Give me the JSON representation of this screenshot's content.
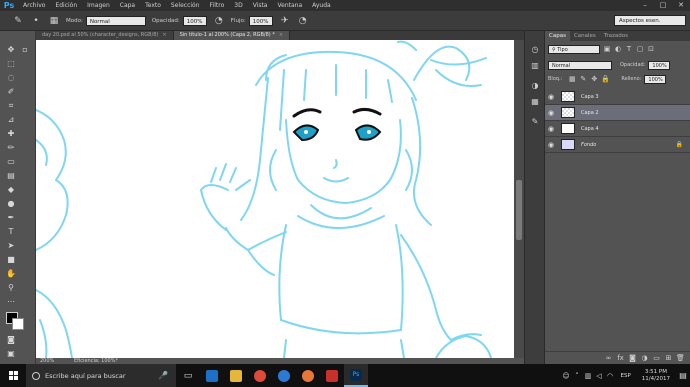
{
  "app": {
    "logo": "Ps"
  },
  "menu": [
    "Archivo",
    "Edición",
    "Imagen",
    "Capa",
    "Texto",
    "Selección",
    "Filtro",
    "3D",
    "Vista",
    "Ventana",
    "Ayuda"
  ],
  "window_controls": {
    "minimize": "–",
    "maximize": "□",
    "close": "✕"
  },
  "options": {
    "mode_label": "Modo:",
    "mode_value": "Normal",
    "opacity_label": "Opacidad:",
    "opacity_value": "100%",
    "flow_label": "Flujo:",
    "flow_value": "100%",
    "workspace": "Aspectos esen."
  },
  "tabs": [
    {
      "label": "day 20.psd al 50% (character_designs, RGB/8)",
      "active": false
    },
    {
      "label": "Sin título-1 al 200% (Capa 2, RGB/8) *",
      "active": true
    }
  ],
  "status": {
    "zoom": "200%",
    "info": "Eficiencia: 100%*"
  },
  "panel": {
    "tabs": [
      "Capas",
      "Canales",
      "Trazados"
    ],
    "filter_value": "Tipo",
    "blend_mode": "Normal",
    "opacity_label": "Opacidad:",
    "opacity_value": "100%",
    "lock_label": "Bloq.:",
    "fill_label": "Relleno:",
    "fill_value": "100%",
    "layers": [
      {
        "name": "Capa 3",
        "thumb": "checker",
        "selected": false
      },
      {
        "name": "Capa 2",
        "thumb": "checker",
        "selected": true
      },
      {
        "name": "Capa 4",
        "thumb": "white",
        "selected": false
      },
      {
        "name": "Fondo",
        "thumb": "lavender",
        "selected": false,
        "locked": true
      }
    ]
  },
  "taskbar": {
    "search_placeholder": "Escribe aquí para buscar",
    "lang": "ESP",
    "time": "3:51 PM",
    "date": "11/4/2017"
  },
  "colors": {
    "sketch": "#7fd6f2",
    "eyes": "#1fa0c8",
    "accent": "#31a8ff"
  }
}
